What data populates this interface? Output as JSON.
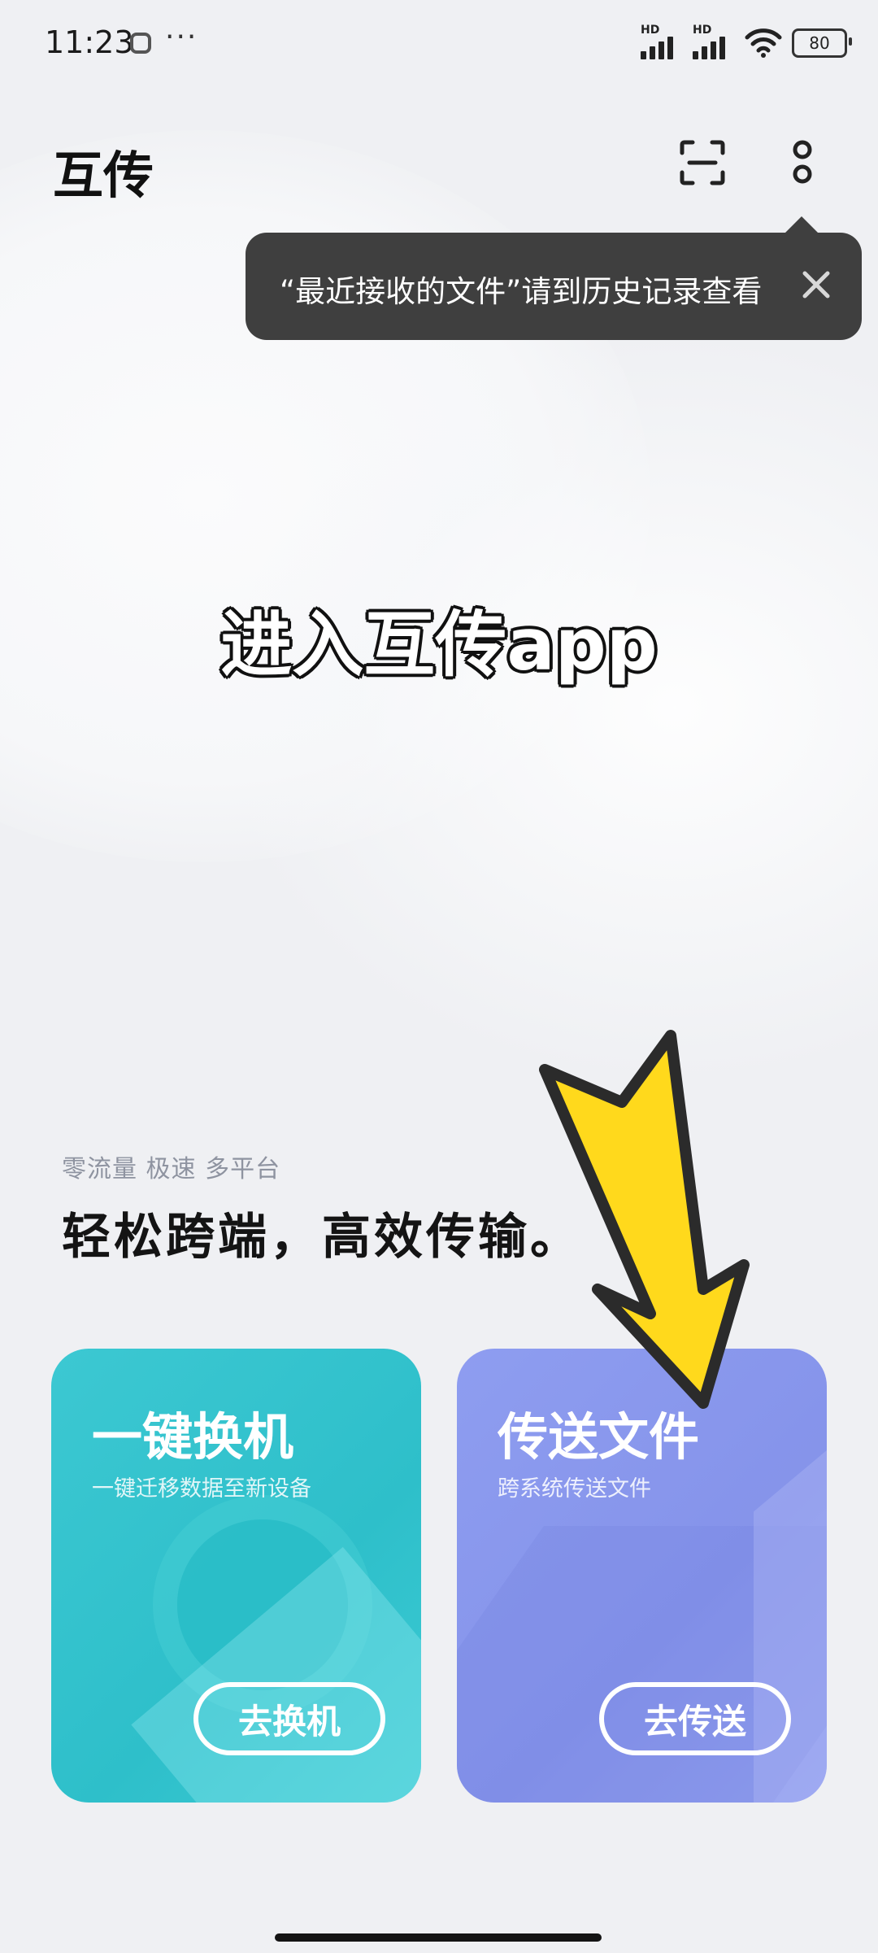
{
  "status_bar": {
    "time": "11:23",
    "more": "···",
    "signal1_label": "HD",
    "signal2_label": "HD",
    "battery": "80"
  },
  "header": {
    "title": "互传"
  },
  "tooltip": {
    "text": "“最近接收的文件”请到历史记录查看"
  },
  "overlay_caption": "进入互传app",
  "promo": {
    "tagline": "零流量 极速 多平台",
    "headline": "轻松跨端，高效传输。"
  },
  "cards": [
    {
      "title": "一键换机",
      "subtitle": "一键迁移数据至新设备",
      "button": "去换机",
      "color": "#36c4cf"
    },
    {
      "title": "传送文件",
      "subtitle": "跨系统传送文件",
      "button": "去传送",
      "color": "#8a98ee"
    }
  ],
  "annotation": {
    "arrow_color": "#ffd91c",
    "arrow_outline": "#2b2b2b"
  }
}
